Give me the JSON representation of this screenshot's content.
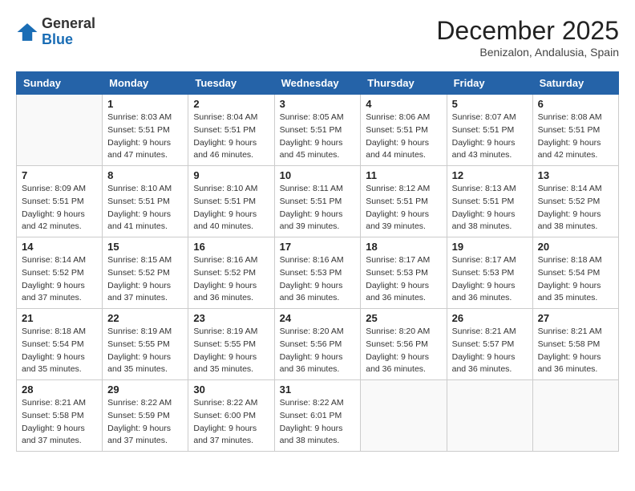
{
  "header": {
    "logo_general": "General",
    "logo_blue": "Blue",
    "month_year": "December 2025",
    "location": "Benizalon, Andalusia, Spain"
  },
  "weekdays": [
    "Sunday",
    "Monday",
    "Tuesday",
    "Wednesday",
    "Thursday",
    "Friday",
    "Saturday"
  ],
  "weeks": [
    [
      {
        "day": "",
        "info": ""
      },
      {
        "day": "1",
        "info": "Sunrise: 8:03 AM\nSunset: 5:51 PM\nDaylight: 9 hours\nand 47 minutes."
      },
      {
        "day": "2",
        "info": "Sunrise: 8:04 AM\nSunset: 5:51 PM\nDaylight: 9 hours\nand 46 minutes."
      },
      {
        "day": "3",
        "info": "Sunrise: 8:05 AM\nSunset: 5:51 PM\nDaylight: 9 hours\nand 45 minutes."
      },
      {
        "day": "4",
        "info": "Sunrise: 8:06 AM\nSunset: 5:51 PM\nDaylight: 9 hours\nand 44 minutes."
      },
      {
        "day": "5",
        "info": "Sunrise: 8:07 AM\nSunset: 5:51 PM\nDaylight: 9 hours\nand 43 minutes."
      },
      {
        "day": "6",
        "info": "Sunrise: 8:08 AM\nSunset: 5:51 PM\nDaylight: 9 hours\nand 42 minutes."
      }
    ],
    [
      {
        "day": "7",
        "info": "Sunrise: 8:09 AM\nSunset: 5:51 PM\nDaylight: 9 hours\nand 42 minutes."
      },
      {
        "day": "8",
        "info": "Sunrise: 8:10 AM\nSunset: 5:51 PM\nDaylight: 9 hours\nand 41 minutes."
      },
      {
        "day": "9",
        "info": "Sunrise: 8:10 AM\nSunset: 5:51 PM\nDaylight: 9 hours\nand 40 minutes."
      },
      {
        "day": "10",
        "info": "Sunrise: 8:11 AM\nSunset: 5:51 PM\nDaylight: 9 hours\nand 39 minutes."
      },
      {
        "day": "11",
        "info": "Sunrise: 8:12 AM\nSunset: 5:51 PM\nDaylight: 9 hours\nand 39 minutes."
      },
      {
        "day": "12",
        "info": "Sunrise: 8:13 AM\nSunset: 5:51 PM\nDaylight: 9 hours\nand 38 minutes."
      },
      {
        "day": "13",
        "info": "Sunrise: 8:14 AM\nSunset: 5:52 PM\nDaylight: 9 hours\nand 38 minutes."
      }
    ],
    [
      {
        "day": "14",
        "info": "Sunrise: 8:14 AM\nSunset: 5:52 PM\nDaylight: 9 hours\nand 37 minutes."
      },
      {
        "day": "15",
        "info": "Sunrise: 8:15 AM\nSunset: 5:52 PM\nDaylight: 9 hours\nand 37 minutes."
      },
      {
        "day": "16",
        "info": "Sunrise: 8:16 AM\nSunset: 5:52 PM\nDaylight: 9 hours\nand 36 minutes."
      },
      {
        "day": "17",
        "info": "Sunrise: 8:16 AM\nSunset: 5:53 PM\nDaylight: 9 hours\nand 36 minutes."
      },
      {
        "day": "18",
        "info": "Sunrise: 8:17 AM\nSunset: 5:53 PM\nDaylight: 9 hours\nand 36 minutes."
      },
      {
        "day": "19",
        "info": "Sunrise: 8:17 AM\nSunset: 5:53 PM\nDaylight: 9 hours\nand 36 minutes."
      },
      {
        "day": "20",
        "info": "Sunrise: 8:18 AM\nSunset: 5:54 PM\nDaylight: 9 hours\nand 35 minutes."
      }
    ],
    [
      {
        "day": "21",
        "info": "Sunrise: 8:18 AM\nSunset: 5:54 PM\nDaylight: 9 hours\nand 35 minutes."
      },
      {
        "day": "22",
        "info": "Sunrise: 8:19 AM\nSunset: 5:55 PM\nDaylight: 9 hours\nand 35 minutes."
      },
      {
        "day": "23",
        "info": "Sunrise: 8:19 AM\nSunset: 5:55 PM\nDaylight: 9 hours\nand 35 minutes."
      },
      {
        "day": "24",
        "info": "Sunrise: 8:20 AM\nSunset: 5:56 PM\nDaylight: 9 hours\nand 36 minutes."
      },
      {
        "day": "25",
        "info": "Sunrise: 8:20 AM\nSunset: 5:56 PM\nDaylight: 9 hours\nand 36 minutes."
      },
      {
        "day": "26",
        "info": "Sunrise: 8:21 AM\nSunset: 5:57 PM\nDaylight: 9 hours\nand 36 minutes."
      },
      {
        "day": "27",
        "info": "Sunrise: 8:21 AM\nSunset: 5:58 PM\nDaylight: 9 hours\nand 36 minutes."
      }
    ],
    [
      {
        "day": "28",
        "info": "Sunrise: 8:21 AM\nSunset: 5:58 PM\nDaylight: 9 hours\nand 37 minutes."
      },
      {
        "day": "29",
        "info": "Sunrise: 8:22 AM\nSunset: 5:59 PM\nDaylight: 9 hours\nand 37 minutes."
      },
      {
        "day": "30",
        "info": "Sunrise: 8:22 AM\nSunset: 6:00 PM\nDaylight: 9 hours\nand 37 minutes."
      },
      {
        "day": "31",
        "info": "Sunrise: 8:22 AM\nSunset: 6:01 PM\nDaylight: 9 hours\nand 38 minutes."
      },
      {
        "day": "",
        "info": ""
      },
      {
        "day": "",
        "info": ""
      },
      {
        "day": "",
        "info": ""
      }
    ]
  ]
}
